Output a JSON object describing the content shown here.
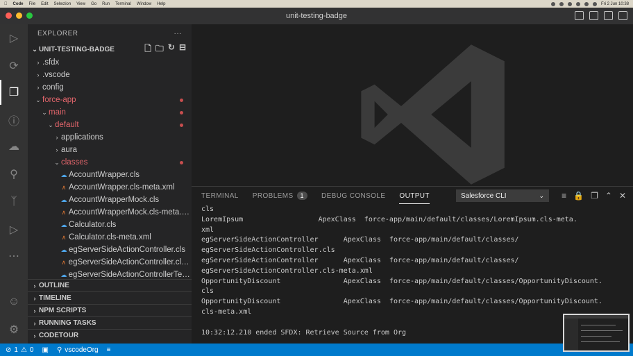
{
  "menubar": {
    "app_name": "Code",
    "menus": [
      "File",
      "Edit",
      "Selection",
      "View",
      "Go",
      "Run",
      "Terminal",
      "Window",
      "Help"
    ],
    "clock": "Fri 2 Jun  10:38"
  },
  "window": {
    "title": "unit-testing-badge"
  },
  "sidebar": {
    "title": "EXPLORER",
    "more_label": "···",
    "folder": "UNIT-TESTING-BADGE",
    "tree": [
      {
        "label": ".sfdx",
        "indent": 1,
        "kind": "folder",
        "expanded": false,
        "modified": false
      },
      {
        "label": ".vscode",
        "indent": 1,
        "kind": "folder",
        "expanded": false,
        "modified": false
      },
      {
        "label": "config",
        "indent": 1,
        "kind": "folder",
        "expanded": false,
        "modified": false
      },
      {
        "label": "force-app",
        "indent": 1,
        "kind": "folder",
        "expanded": true,
        "modified": true
      },
      {
        "label": "main",
        "indent": 2,
        "kind": "folder",
        "expanded": true,
        "modified": true
      },
      {
        "label": "default",
        "indent": 3,
        "kind": "folder",
        "expanded": true,
        "modified": true
      },
      {
        "label": "applications",
        "indent": 4,
        "kind": "folder",
        "expanded": false,
        "modified": false
      },
      {
        "label": "aura",
        "indent": 4,
        "kind": "folder",
        "expanded": false,
        "modified": false
      },
      {
        "label": "classes",
        "indent": 4,
        "kind": "folder",
        "expanded": true,
        "modified": true
      },
      {
        "label": "AccountWrapper.cls",
        "indent": 5,
        "kind": "salesforce",
        "modified": false
      },
      {
        "label": "AccountWrapper.cls-meta.xml",
        "indent": 5,
        "kind": "xml",
        "modified": false
      },
      {
        "label": "AccountWrapperMock.cls",
        "indent": 5,
        "kind": "salesforce",
        "modified": false
      },
      {
        "label": "AccountWrapperMock.cls-meta.xml",
        "indent": 5,
        "kind": "xml",
        "modified": false
      },
      {
        "label": "Calculator.cls",
        "indent": 5,
        "kind": "salesforce",
        "modified": false
      },
      {
        "label": "Calculator.cls-meta.xml",
        "indent": 5,
        "kind": "xml",
        "modified": false
      },
      {
        "label": "egServerSideActionController.cls",
        "indent": 5,
        "kind": "salesforce",
        "modified": false
      },
      {
        "label": "egServerSideActionController.cls-...",
        "indent": 5,
        "kind": "xml",
        "modified": false
      },
      {
        "label": "egServerSideActionControllerTest...",
        "indent": 5,
        "kind": "salesforce",
        "modified": false
      }
    ],
    "sections": [
      "OUTLINE",
      "TIMELINE",
      "NPM SCRIPTS",
      "RUNNING TASKS",
      "CODETOUR"
    ]
  },
  "panel": {
    "tabs": [
      {
        "label": "TERMINAL",
        "active": false
      },
      {
        "label": "PROBLEMS",
        "active": false,
        "badge": "1"
      },
      {
        "label": "DEBUG CONSOLE",
        "active": false
      },
      {
        "label": "OUTPUT",
        "active": true
      }
    ],
    "channel": "Salesforce CLI",
    "output_lines": [
      "cls",
      "LoremIpsum                  ApexClass  force-app/main/default/classes/LoremIpsum.cls-meta.",
      "xml",
      "egServerSideActionController      ApexClass  force-app/main/default/classes/",
      "egServerSideActionController.cls",
      "egServerSideActionController      ApexClass  force-app/main/default/classes/",
      "egServerSideActionController.cls-meta.xml",
      "OpportunityDiscount               ApexClass  force-app/main/default/classes/OpportunityDiscount.",
      "cls",
      "OpportunityDiscount               ApexClass  force-app/main/default/classes/OpportunityDiscount.",
      "cls-meta.xml",
      "",
      "10:32:12.210 ended SFDX: Retrieve Source from Org"
    ]
  },
  "statusbar": {
    "errors": "1",
    "warnings": "0",
    "org": "vscodeOrg"
  },
  "colors": {
    "accent": "#007acc",
    "modified": "#e2656b"
  }
}
